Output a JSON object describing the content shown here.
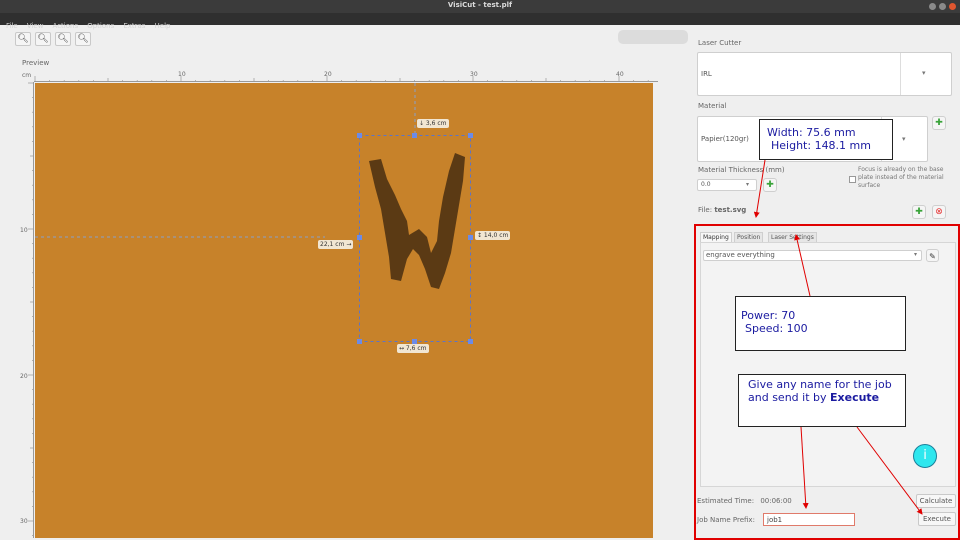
{
  "window": {
    "title": "VisiCut - test.plf"
  },
  "menu": [
    "File",
    "View",
    "Actions",
    "Options",
    "Extras",
    "Help"
  ],
  "toolbar": {
    "zoom_buttons": [
      "zoom-in-icon",
      "zoom-out-icon",
      "zoom-reset-icon",
      "zoom-fit-icon"
    ]
  },
  "preview": {
    "label": "Preview",
    "ruler_unit": "cm",
    "h_ticks": [
      "10",
      "20",
      "30",
      "40"
    ],
    "v_ticks": [
      "10",
      "20",
      "30"
    ],
    "dims": {
      "top": "↓ 3,6 cm",
      "left": "22,1 cm →",
      "right": "↕ 14,0 cm",
      "bottom": "↔ 7,6 cm"
    },
    "canvas_color": "#c7822a",
    "shape_color": "#5b3a14"
  },
  "side": {
    "laser_cutter_label": "Laser Cutter",
    "laser_cutter_value": "IRL",
    "material_label": "Material",
    "material_value": "Papier(120gr)",
    "thickness_label": "Material Thickness (mm)",
    "thickness_value": "0.0",
    "focus_text": "Focus is already on the base plate instead of the material surface",
    "file_label": "File:",
    "file_name": "test.svg",
    "tabs": [
      "Mapping",
      "Position",
      "Laser Settings"
    ],
    "mapping_value": "engrave everything",
    "estimated_label": "Estimated Time:",
    "estimated_value": "00:06:00",
    "calculate_label": "Calculate",
    "job_prefix_label": "Job Name Prefix:",
    "job_prefix_value": "job1",
    "execute_label": "Execute"
  },
  "annotations": {
    "size_line1": "Width: 75.6 mm",
    "size_line2": "Height: 148.1 mm",
    "power_line": "Power: 70",
    "speed_line": "Speed: 100",
    "job_line1": "Give any name for the job",
    "job_line2": "and send it by",
    "job_bold": "Execute",
    "info_letter": "i"
  },
  "colors": {
    "accent_red": "#e00000",
    "annotation_text": "#1a1aa0",
    "info_circle": "#2ee7ee"
  }
}
